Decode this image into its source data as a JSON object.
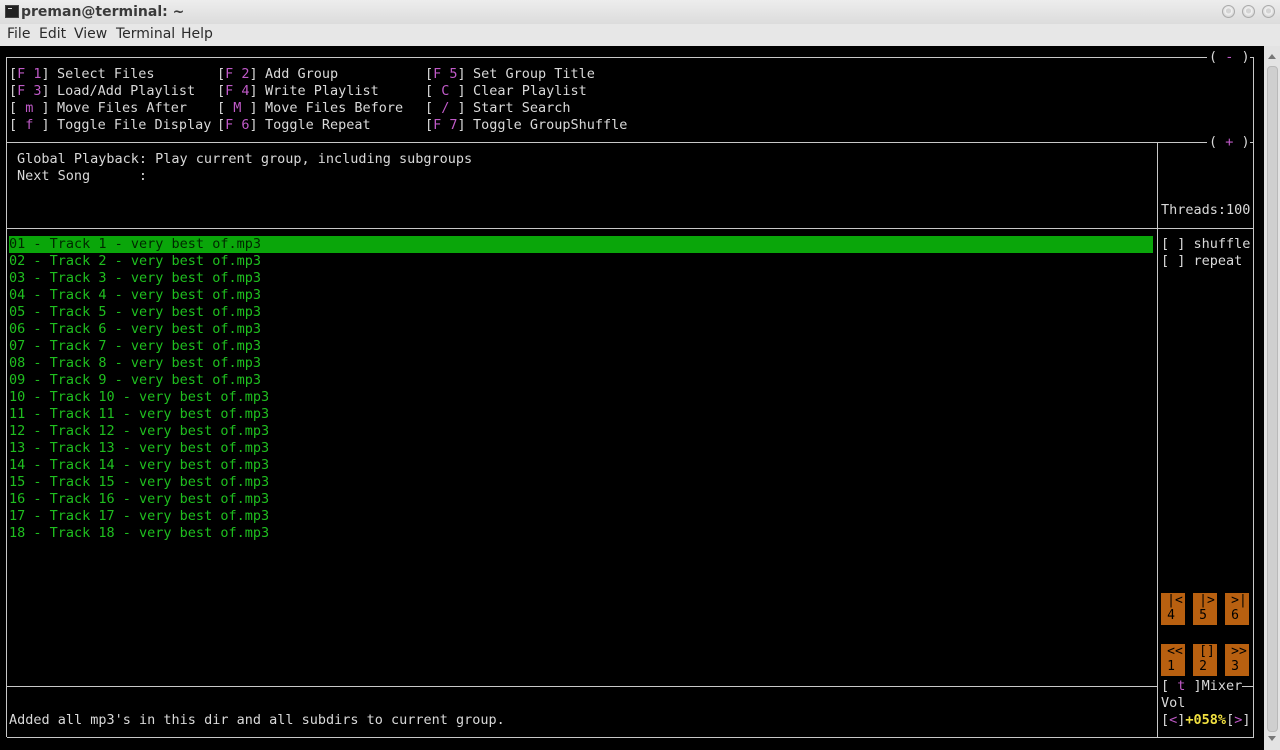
{
  "window": {
    "title": "preman@terminal: ~"
  },
  "menu": [
    "File",
    "Edit",
    "View",
    "Terminal",
    "Help"
  ],
  "panel_toggles": {
    "top": "( - )",
    "middle": "( + )"
  },
  "shortcuts": [
    {
      "key": "F 1",
      "label": "Select Files"
    },
    {
      "key": "F 2",
      "label": "Add Group"
    },
    {
      "key": "F 5",
      "label": "Set Group Title"
    },
    {
      "key": "F 3",
      "label": "Load/Add Playlist"
    },
    {
      "key": "F 4",
      "label": "Write Playlist"
    },
    {
      "key": " C ",
      "label": "Clear Playlist"
    },
    {
      "key": " m ",
      "label": "Move Files After"
    },
    {
      "key": " M ",
      "label": "Move Files Before"
    },
    {
      "key": " / ",
      "label": "Start Search"
    },
    {
      "key": " f ",
      "label": "Toggle File Display"
    },
    {
      "key": "F 6",
      "label": "Toggle Repeat"
    },
    {
      "key": "F 7",
      "label": "Toggle GroupShuffle"
    }
  ],
  "status": {
    "global_playback": "Global Playback: Play current group, including subgroups",
    "next_song": "Next Song      :",
    "threads": "Threads:100"
  },
  "tracks": [
    "01 - Track 1 - very best of.mp3",
    "02 - Track 2 - very best of.mp3",
    "03 - Track 3 - very best of.mp3",
    "04 - Track 4 - very best of.mp3",
    "05 - Track 5 - very best of.mp3",
    "06 - Track 6 - very best of.mp3",
    "07 - Track 7 - very best of.mp3",
    "08 - Track 8 - very best of.mp3",
    "09 - Track 9 - very best of.mp3",
    "10 - Track 10 - very best of.mp3",
    "11 - Track 11 - very best of.mp3",
    "12 - Track 12 - very best of.mp3",
    "13 - Track 13 - very best of.mp3",
    "14 - Track 14 - very best of.mp3",
    "15 - Track 15 - very best of.mp3",
    "16 - Track 16 - very best of.mp3",
    "17 - Track 17 - very best of.mp3",
    "18 - Track 18 - very best of.mp3"
  ],
  "selected_track_index": 0,
  "options": {
    "shuffle": "[ ] shuffle",
    "repeat": "[ ] repeat"
  },
  "controls": [
    {
      "symbol": "|<",
      "number": "4"
    },
    {
      "symbol": "|>",
      "number": "5"
    },
    {
      "symbol": ">|",
      "number": "6"
    },
    {
      "symbol": "<<",
      "number": "1"
    },
    {
      "symbol": "[]",
      "number": "2"
    },
    {
      "symbol": ">>",
      "number": "3"
    }
  ],
  "mixer": {
    "key": "t",
    "label": "Mixer",
    "vol_label": "Vol",
    "dec": "<",
    "volume": "+058%",
    "inc": ">"
  },
  "message": "Added all mp3's in this dir and all subdirs to current group.",
  "colors": {
    "accent_magenta": "#c05ac8",
    "track_green": "#1fbf1f",
    "selected_bg": "#0aa60a",
    "button_orange": "#b86010",
    "volume_yellow": "#f0e040"
  }
}
